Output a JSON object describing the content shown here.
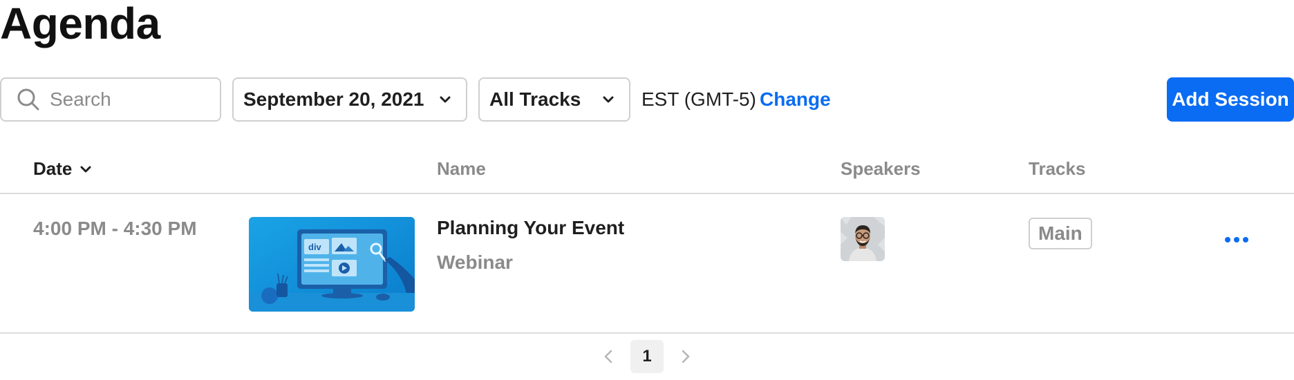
{
  "page": {
    "title": "Agenda"
  },
  "toolbar": {
    "search_placeholder": "Search",
    "date_selected": "September 20, 2021",
    "tracks_selected": "All Tracks",
    "timezone": "EST (GMT-5)",
    "change_label": "Change",
    "add_session_label": "Add Session"
  },
  "table": {
    "columns": {
      "date": "Date",
      "name": "Name",
      "speakers": "Speakers",
      "tracks": "Tracks"
    },
    "rows": [
      {
        "time": "4:00 PM - 4:30 PM",
        "name": "Planning Your Event",
        "type": "Webinar",
        "track": "Main"
      }
    ]
  },
  "pagination": {
    "current_page": "1"
  },
  "colors": {
    "accent": "#0a6cf2",
    "muted": "#8a8a8a",
    "border": "#cfcfcf"
  }
}
